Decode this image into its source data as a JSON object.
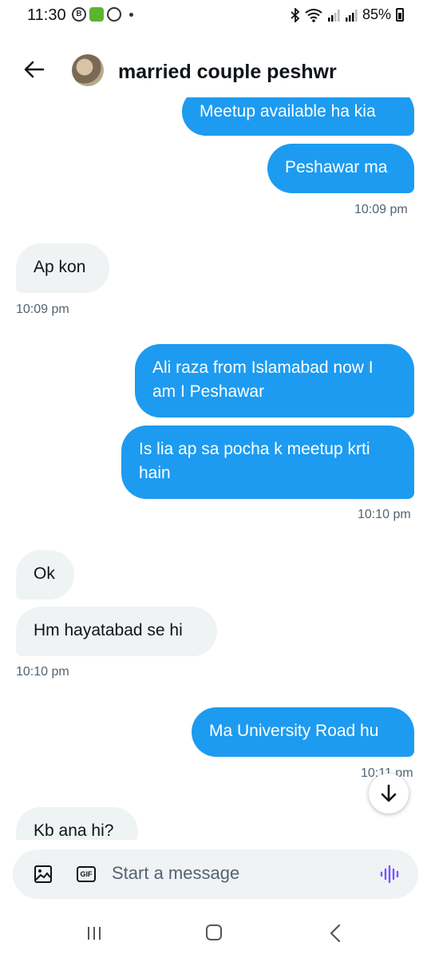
{
  "status_bar": {
    "time": "11:30",
    "battery": "85%"
  },
  "header": {
    "contact_name": "married couple peshwr"
  },
  "messages": [
    {
      "text": "Meetup available ha kia"
    },
    {
      "text": "Peshawar ma"
    },
    {
      "time": "10:09 pm"
    },
    {
      "text": "Ap kon"
    },
    {
      "time": "10:09 pm"
    },
    {
      "text": "Ali raza from Islamabad now I am I Peshawar"
    },
    {
      "text": "Is lia ap sa pocha k meetup krti hain"
    },
    {
      "time": "10:10 pm"
    },
    {
      "text": "Ok"
    },
    {
      "text": "Hm hayatabad se hi"
    },
    {
      "time": "10:10 pm"
    },
    {
      "text": "Ma University Road hu"
    },
    {
      "time": "10:11 pm"
    },
    {
      "text": "Kb ana hi?"
    }
  ],
  "composer": {
    "placeholder": "Start a message",
    "gif_label": "GIF"
  },
  "icons": {
    "back": "arrow-left-icon",
    "image": "image-icon",
    "gif": "gif-icon",
    "voice": "voice-wave-icon",
    "scroll": "arrow-down-icon"
  },
  "colors": {
    "accent": "#1d9bf0",
    "incoming_bubble": "#eff3f4",
    "voice_icon": "#7856ff"
  }
}
